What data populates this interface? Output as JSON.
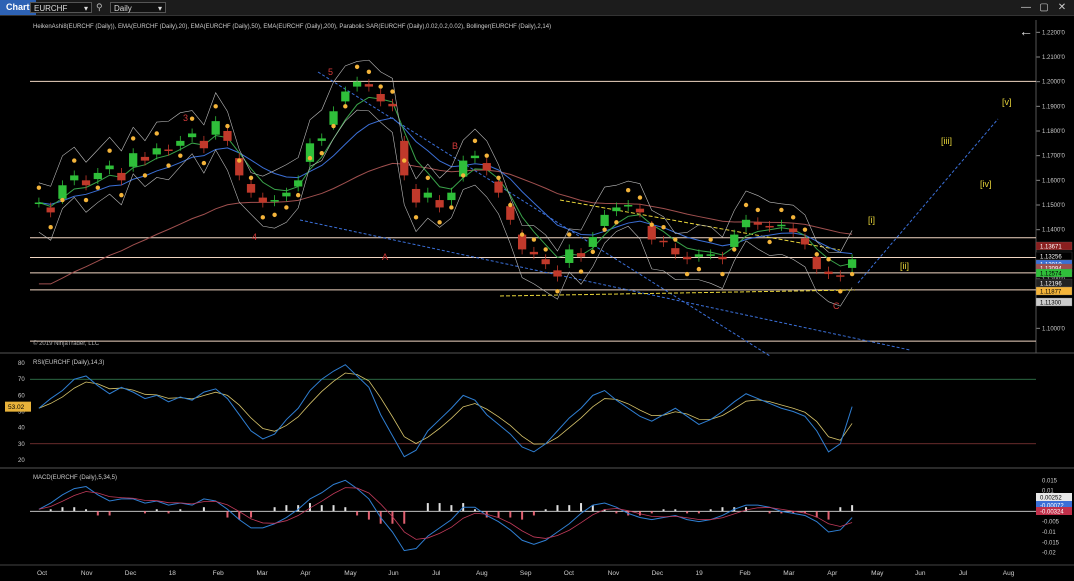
{
  "window": {
    "tab_label": "Chart",
    "instrument": "EURCHF",
    "interval": "Daily",
    "min_label": "—",
    "max_label": "▢",
    "close_label": "✕"
  },
  "colors": {
    "background": "#000000",
    "grid": "#1e1e1e",
    "candle_up": "#2fbf3a",
    "candle_down": "#c0392b",
    "sar": "#f4b43a",
    "bollinger": "#bbbbbb",
    "ema20": "#3aa34a",
    "ema50": "#3b6fd6",
    "ema200": "#a0504f",
    "channel": "#3a6fd8",
    "hline": "#f1d6c3",
    "rsi": "#2f7fd3",
    "rsi_signal": "#d6c36a",
    "macd_pos": "#e0e0e0",
    "macd_neg": "#e06070",
    "wave_label_red": "#d43a3a",
    "wave_label_yellow": "#e8d53a"
  },
  "chart_data": [
    {
      "type": "line",
      "panel": "price",
      "title": "HeikenAshi8(EURCHF (Daily)), EMA(EURCHF (Daily),20), EMA(EURCHF (Daily),50), EMA(EURCHF (Daily),200), Parabolic SAR(EURCHF (Daily),0.02,0.2,0.02), Bollinger(EURCHF (Daily),2,14)",
      "ylim": [
        1.09,
        1.225
      ],
      "y_ticks": [
        "1.2200'0",
        "1.2100'0",
        "1.2000'0",
        "1.1900'0",
        "1.1800'0",
        "1.1700'0",
        "1.1600'0",
        "1.1500'0",
        "1.1400'0",
        "1.1300'0",
        "1.1200'0",
        "1.1100'0",
        "1.1000'0"
      ],
      "x_labels": [
        "Oct",
        "Nov",
        "Dec",
        "18",
        "Feb",
        "Mar",
        "Apr",
        "May",
        "Jun",
        "Jul",
        "Aug",
        "Sep",
        "Oct",
        "Nov",
        "Dec",
        "19",
        "Feb",
        "Mar",
        "Apr",
        "May",
        "Jun",
        "Jul",
        "Aug"
      ],
      "series": [
        {
          "values": [
            1.151,
            1.147,
            1.158,
            1.162,
            1.158,
            1.163,
            1.166,
            1.16,
            1.171,
            1.168,
            1.173,
            1.172,
            1.176,
            1.179,
            1.173,
            1.184,
            1.176,
            1.162,
            1.155,
            1.151,
            1.152,
            1.155,
            1.16,
            1.175,
            1.177,
            1.188,
            1.196,
            1.2,
            1.198,
            1.192,
            1.19,
            1.162,
            1.151,
            1.155,
            1.149,
            1.155,
            1.168,
            1.17,
            1.164,
            1.155,
            1.144,
            1.132,
            1.13,
            1.126,
            1.121,
            1.132,
            1.129,
            1.137,
            1.146,
            1.149,
            1.15,
            1.147,
            1.136,
            1.135,
            1.13,
            1.128,
            1.13,
            1.13,
            1.128,
            1.138,
            1.144,
            1.142,
            1.141,
            1.142,
            1.139,
            1.134,
            1.124,
            1.122,
            1.121,
            1.128
          ]
        }
      ],
      "horizontal_lines": [
        1.2001,
        1.1367,
        1.1287,
        1.1225,
        1.1156,
        1.0948
      ],
      "price_labels": [
        {
          "text": "1.13671",
          "color": "#8a1f1f"
        },
        {
          "text": "1.13256",
          "color": "#000000"
        },
        {
          "text": "1.13019",
          "color": "#3b6fd6"
        },
        {
          "text": "1.13094",
          "color": "#a0504f"
        },
        {
          "text": "1.12574",
          "color": "#2fbf3a"
        },
        {
          "text": "1.12196",
          "color": "#222222"
        },
        {
          "text": "1.11877",
          "color": "#f4b43a"
        },
        {
          "text": "1.11300",
          "color": "#cccccc"
        }
      ],
      "wave_labels": [
        {
          "text": "3",
          "color": "red"
        },
        {
          "text": "4",
          "color": "red"
        },
        {
          "text": "5",
          "color": "red"
        },
        {
          "text": "B",
          "color": "red"
        },
        {
          "text": "A",
          "color": "red"
        },
        {
          "text": "C",
          "color": "red"
        },
        {
          "text": "[i]",
          "color": "yellow"
        },
        {
          "text": "[ii]",
          "color": "yellow"
        },
        {
          "text": "[iii]",
          "color": "yellow"
        },
        {
          "text": "[iv]",
          "color": "yellow"
        },
        {
          "text": "[v]",
          "color": "yellow"
        }
      ],
      "watermark": "© 2019 NinjaTrader, LLC"
    },
    {
      "type": "line",
      "panel": "rsi",
      "title": "RSI(EURCHF (Daily),14,3)",
      "ylim": [
        15,
        85
      ],
      "y_ticks": [
        "80",
        "70",
        "60",
        "50",
        "40",
        "30",
        "20"
      ],
      "overbought": 70,
      "oversold": 30,
      "current_label": "53.02",
      "series": [
        {
          "values": [
            52,
            58,
            63,
            70,
            72,
            66,
            61,
            65,
            62,
            58,
            60,
            56,
            59,
            57,
            62,
            64,
            58,
            48,
            38,
            33,
            36,
            45,
            52,
            63,
            70,
            75,
            79,
            72,
            65,
            48,
            35,
            22,
            26,
            38,
            45,
            52,
            60,
            57,
            48,
            42,
            36,
            28,
            25,
            30,
            38,
            46,
            52,
            60,
            63,
            57,
            52,
            47,
            44,
            48,
            52,
            47,
            42,
            45,
            50,
            56,
            61,
            58,
            55,
            52,
            50,
            47,
            38,
            25,
            30,
            53
          ]
        }
      ]
    },
    {
      "type": "bar",
      "panel": "macd",
      "title": "MACD(EURCHF (Daily),5,34,5)",
      "ylim": [
        -0.025,
        0.02
      ],
      "y_ticks": [
        "0.015",
        "0.01",
        "0.005",
        "0",
        "-0.005",
        "-0.01",
        "-0.015",
        "-0.02"
      ],
      "value_labels": [
        "0.00252",
        "-0.00072",
        "-0.00324"
      ],
      "series": [
        {
          "name": "macd",
          "values": [
            0.001,
            0.004,
            0.008,
            0.011,
            0.012,
            0.008,
            0.005,
            0.006,
            0.006,
            0.004,
            0.005,
            0.003,
            0.004,
            0.003,
            0.006,
            0.005,
            0.001,
            -0.004,
            -0.008,
            -0.008,
            -0.006,
            -0.003,
            0.001,
            0.006,
            0.009,
            0.013,
            0.015,
            0.011,
            0.006,
            -0.003,
            -0.01,
            -0.019,
            -0.018,
            -0.012,
            -0.008,
            -0.004,
            0.002,
            0.002,
            -0.002,
            -0.005,
            -0.009,
            -0.014,
            -0.016,
            -0.014,
            -0.01,
            -0.006,
            -0.001,
            0.003,
            0.004,
            0.002,
            -0.001,
            -0.003,
            -0.004,
            -0.003,
            -0.002,
            -0.004,
            -0.005,
            -0.004,
            -0.002,
            0.001,
            0.003,
            0.003,
            0.002,
            0.0,
            -0.001,
            -0.002,
            -0.005,
            -0.01,
            -0.009,
            -0.003
          ]
        },
        {
          "name": "histogram",
          "values": [
            0.0,
            0.001,
            0.002,
            0.002,
            0.001,
            -0.002,
            -0.002,
            0.0,
            0.0,
            -0.001,
            0.001,
            -0.001,
            0.001,
            0.0,
            0.002,
            0.0,
            -0.003,
            -0.004,
            -0.003,
            0.0,
            0.002,
            0.003,
            0.003,
            0.004,
            0.003,
            0.003,
            0.002,
            -0.002,
            -0.004,
            -0.006,
            -0.006,
            -0.006,
            0.0,
            0.004,
            0.004,
            0.003,
            0.004,
            0.001,
            -0.003,
            -0.003,
            -0.003,
            -0.004,
            -0.002,
            0.001,
            0.003,
            0.003,
            0.004,
            0.003,
            0.001,
            -0.001,
            -0.002,
            -0.002,
            -0.001,
            0.001,
            0.001,
            -0.001,
            -0.001,
            0.001,
            0.002,
            0.002,
            0.002,
            0.0,
            -0.001,
            -0.001,
            -0.001,
            -0.001,
            -0.003,
            -0.004,
            0.002,
            0.003
          ]
        }
      ]
    }
  ]
}
